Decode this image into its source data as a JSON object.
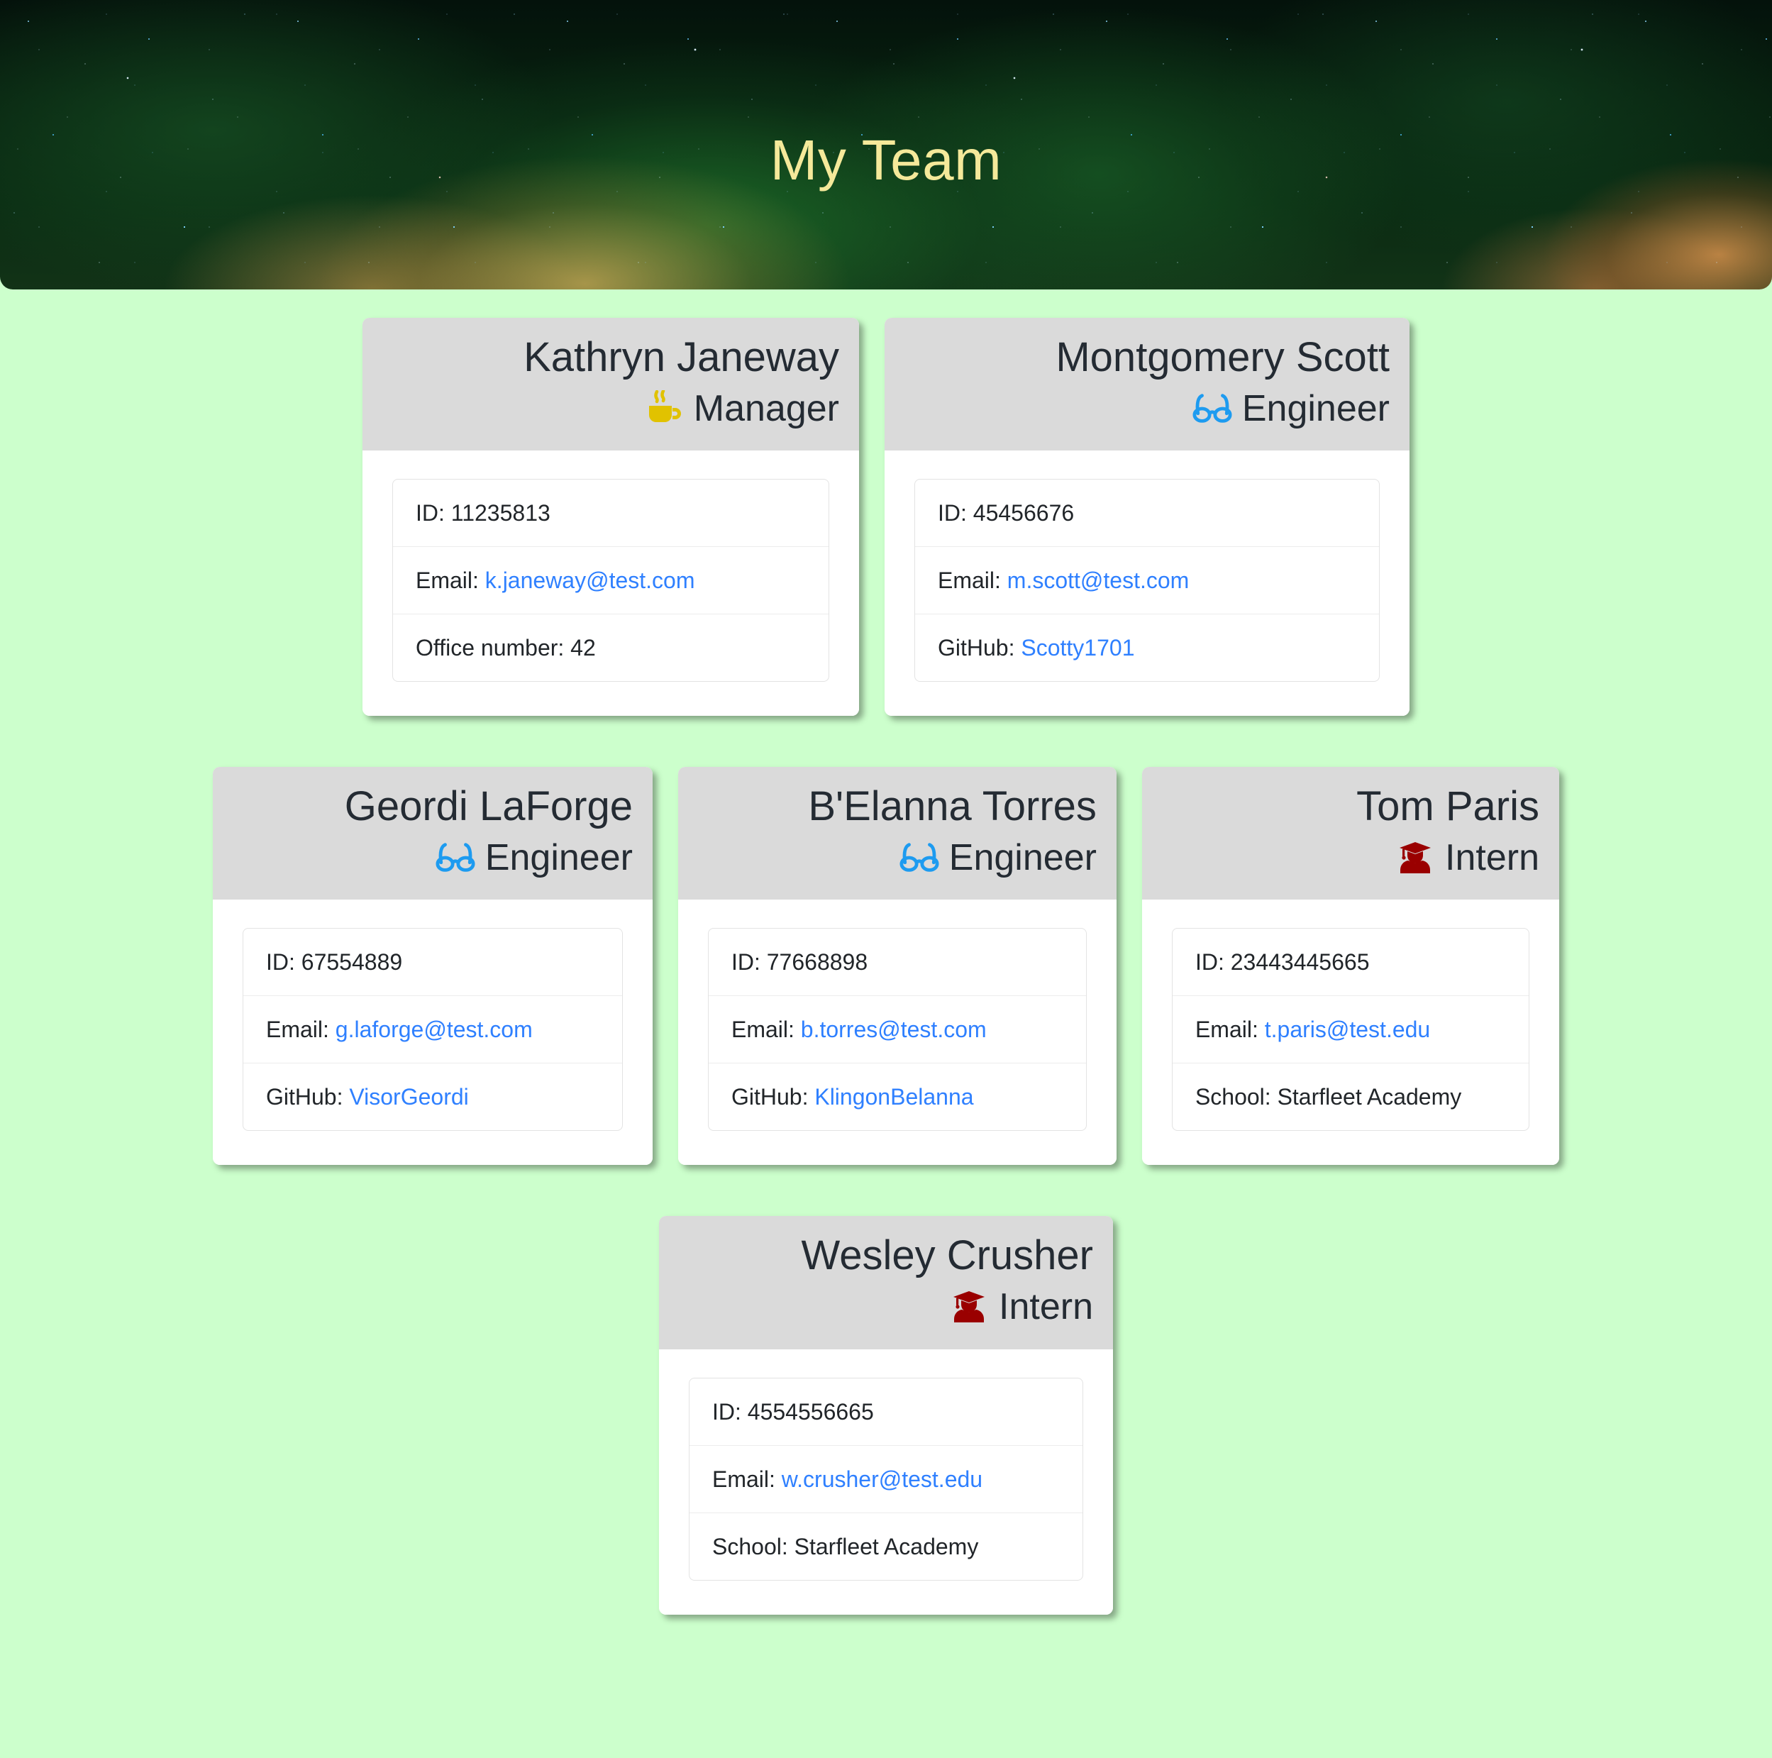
{
  "banner": {
    "title": "My Team",
    "title_color": "#F5E99A",
    "background_description": "space-nebula-photo"
  },
  "page": {
    "background_color": "#CCFFCC",
    "card_header_color": "#DADADA",
    "link_color": "#2F80FF",
    "text_color": "#242B33"
  },
  "roles": {
    "manager": {
      "label": "Manager",
      "icon": "coffee-cup-icon",
      "color": "#E1C200"
    },
    "engineer": {
      "label": "Engineer",
      "icon": "glasses-icon",
      "color": "#1D9BF0"
    },
    "intern": {
      "label": "Intern",
      "icon": "graduate-student-icon",
      "color": "#9A0000"
    }
  },
  "team": [
    {
      "name": "Kathryn Janeway",
      "role": "Manager",
      "role_icon": "coffee-cup-icon",
      "details": [
        {
          "label": "ID:",
          "value": "11235813",
          "link": false
        },
        {
          "label": "Email:",
          "value": "k.janeway@test.com",
          "link": true
        },
        {
          "label": "Office number:",
          "value": "42",
          "link": false
        }
      ]
    },
    {
      "name": "Montgomery Scott",
      "role": "Engineer",
      "role_icon": "glasses-icon",
      "details": [
        {
          "label": "ID:",
          "value": "45456676",
          "link": false
        },
        {
          "label": "Email:",
          "value": "m.scott@test.com",
          "link": true
        },
        {
          "label": "GitHub:",
          "value": "Scotty1701",
          "link": true
        }
      ]
    },
    {
      "name": "Geordi LaForge",
      "role": "Engineer",
      "role_icon": "glasses-icon",
      "details": [
        {
          "label": "ID:",
          "value": "67554889",
          "link": false
        },
        {
          "label": "Email:",
          "value": "g.laforge@test.com",
          "link": true
        },
        {
          "label": "GitHub:",
          "value": "VisorGeordi",
          "link": true
        }
      ]
    },
    {
      "name": "B'Elanna Torres",
      "role": "Engineer",
      "role_icon": "glasses-icon",
      "details": [
        {
          "label": "ID:",
          "value": "77668898",
          "link": false
        },
        {
          "label": "Email:",
          "value": "b.torres@test.com",
          "link": true
        },
        {
          "label": "GitHub:",
          "value": "KlingonBelanna",
          "link": true
        }
      ]
    },
    {
      "name": "Tom Paris",
      "role": "Intern",
      "role_icon": "graduate-student-icon",
      "details": [
        {
          "label": "ID:",
          "value": "23443445665",
          "link": false
        },
        {
          "label": "Email:",
          "value": "t.paris@test.edu",
          "link": true
        },
        {
          "label": "School:",
          "value": "Starfleet Academy",
          "link": false
        }
      ]
    },
    {
      "name": "Wesley Crusher",
      "role": "Intern",
      "role_icon": "graduate-student-icon",
      "details": [
        {
          "label": "ID:",
          "value": "4554556665",
          "link": false
        },
        {
          "label": "Email:",
          "value": "w.crusher@test.edu",
          "link": true
        },
        {
          "label": "School:",
          "value": "Starfleet Academy",
          "link": false
        }
      ]
    }
  ]
}
